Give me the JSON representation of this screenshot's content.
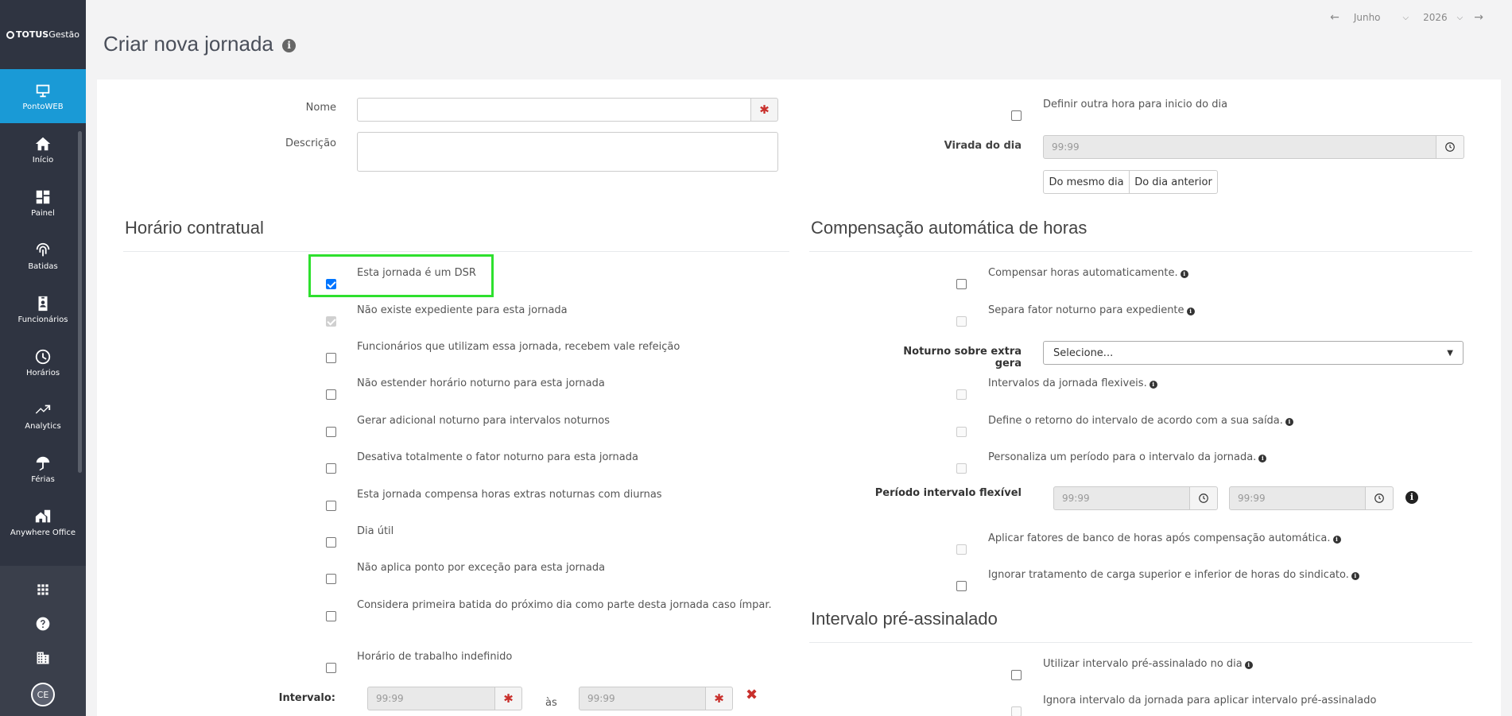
{
  "app": {
    "logo_brand": "TOTUS",
    "logo_suffix": "Gestão"
  },
  "sidebar": {
    "items": [
      {
        "label": "PontoWEB",
        "icon": "monitor-icon"
      },
      {
        "label": "Início",
        "icon": "home-icon"
      },
      {
        "label": "Painel",
        "icon": "dashboard-icon"
      },
      {
        "label": "Batidas",
        "icon": "fingerprint-icon"
      },
      {
        "label": "Funcionários",
        "icon": "badge-icon"
      },
      {
        "label": "Horários",
        "icon": "clock-icon"
      },
      {
        "label": "Analytics",
        "icon": "trend-icon"
      },
      {
        "label": "Férias",
        "icon": "umbrella-icon"
      },
      {
        "label": "Anywhere Office",
        "icon": "home-work-icon"
      }
    ],
    "avatar_initials": "CE"
  },
  "header": {
    "title": "Criar nova jornada",
    "month": "Junho",
    "year": "2026"
  },
  "form": {
    "nome_label": "Nome",
    "nome_value": "",
    "descricao_label": "Descrição",
    "descricao_value": "",
    "definir_hora_label": "Definir outra hora para inicio do dia",
    "virada_label": "Virada do dia",
    "virada_placeholder": "99:99",
    "btn_mesmo_dia": "Do mesmo dia",
    "btn_dia_anterior": "Do dia anterior"
  },
  "horario_contratual": {
    "title": "Horário contratual",
    "options": [
      {
        "label": "Esta jornada é um DSR",
        "checked": true,
        "disabled": false
      },
      {
        "label": "Não existe expediente para esta jornada",
        "checked": true,
        "disabled": true
      },
      {
        "label": "Funcionários que utilizam essa jornada, recebem vale refeição",
        "checked": false,
        "disabled": false
      },
      {
        "label": "Não estender horário noturno para esta jornada",
        "checked": false,
        "disabled": false
      },
      {
        "label": "Gerar adicional noturno para intervalos noturnos",
        "checked": false,
        "disabled": false
      },
      {
        "label": "Desativa totalmente o fator noturno para esta jornada",
        "checked": false,
        "disabled": false
      },
      {
        "label": "Esta jornada compensa horas extras noturnas com diurnas",
        "checked": false,
        "disabled": false
      },
      {
        "label": "Dia útil",
        "checked": false,
        "disabled": false
      },
      {
        "label": "Não aplica ponto por exceção para esta jornada",
        "checked": false,
        "disabled": false
      },
      {
        "label": "Considera primeira batida do próximo dia como parte desta jornada caso ímpar.",
        "checked": false,
        "disabled": false
      },
      {
        "label": "Horário de trabalho indefinido",
        "checked": false,
        "disabled": false
      }
    ],
    "intervalo_label": "Intervalo:",
    "intervalo_start": "99:99",
    "intervalo_sep": "às",
    "intervalo_end": "99:99"
  },
  "compensacao": {
    "title": "Compensação automática de horas",
    "compensar": "Compensar horas automaticamente.",
    "separa_fator": "Separa fator noturno para expediente",
    "noturno_label": "Noturno sobre extra gera",
    "noturno_selected": "Selecione...",
    "intervalos_flex": "Intervalos da jornada flexiveis.",
    "define_retorno": "Define o retorno do intervalo de acordo com a sua saída.",
    "personaliza": "Personaliza um período para o intervalo da jornada.",
    "periodo_label": "Período intervalo flexível",
    "periodo_start": "99:99",
    "periodo_end": "99:99",
    "aplicar_fatores": "Aplicar fatores de banco de horas após compensação automática.",
    "ignorar_tratamento": "Ignorar tratamento de carga superior e inferior de horas do sindicato."
  },
  "intervalo_pre": {
    "title": "Intervalo pré-assinalado",
    "utilizar": "Utilizar intervalo pré-assinalado no dia",
    "ignora": "Ignora intervalo da jornada para aplicar intervalo pré-assinalado"
  }
}
